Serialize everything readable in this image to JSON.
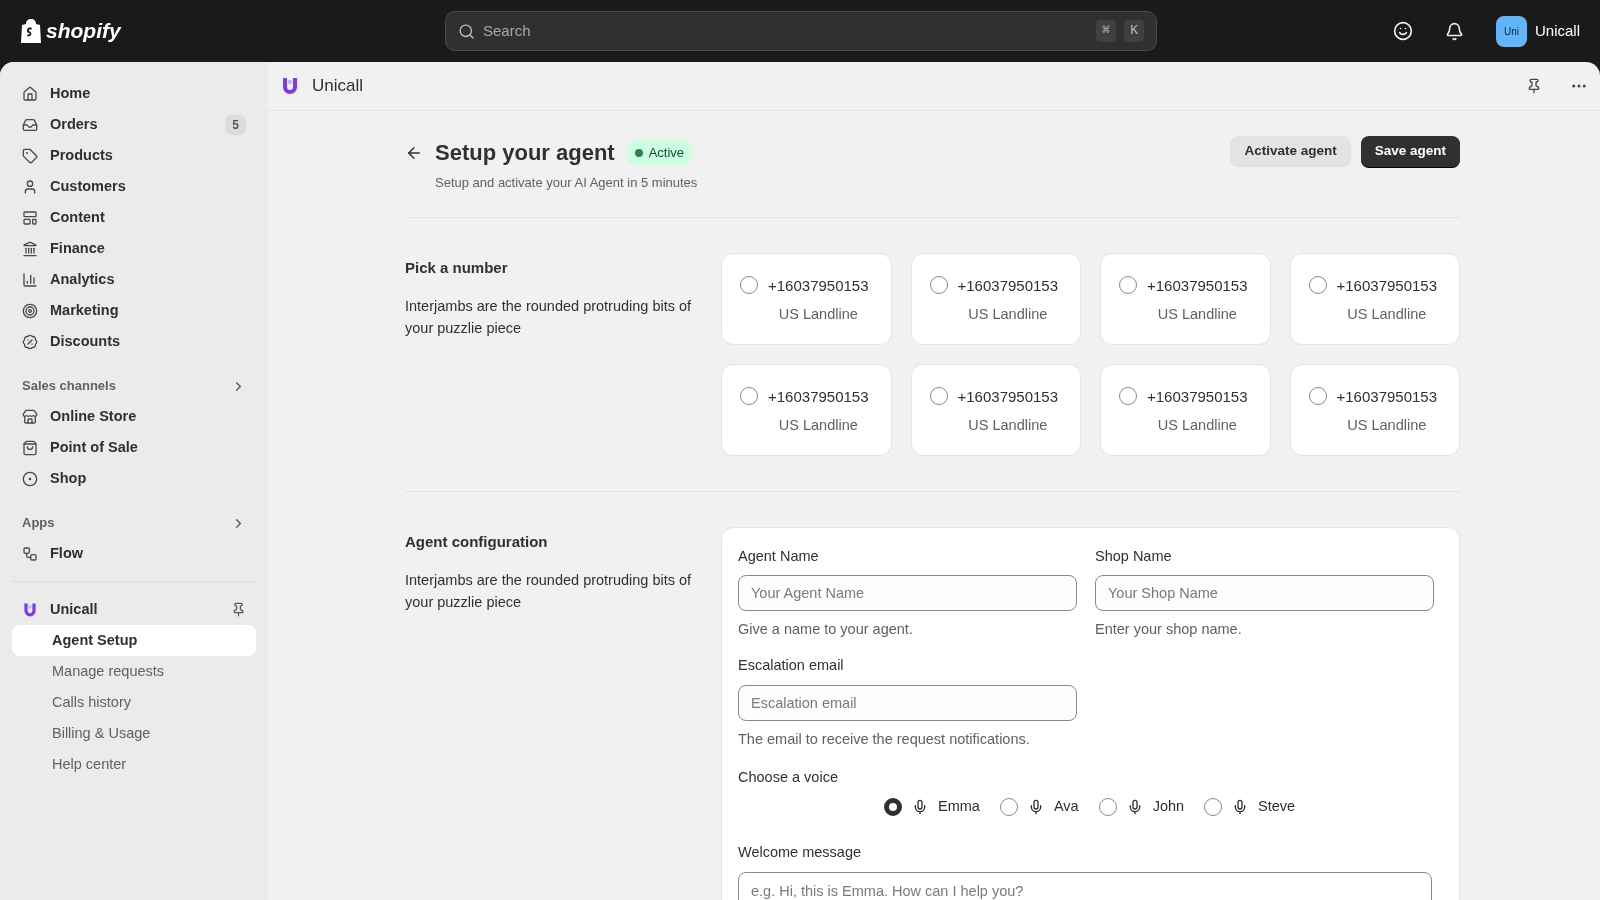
{
  "topbar": {
    "logo_text": "shopify",
    "search": {
      "placeholder": "Search"
    },
    "shortcut_keys": [
      "⌘",
      "K"
    ],
    "account": {
      "avatar": "Uni",
      "name": "Unicall"
    }
  },
  "sidebar": {
    "items": [
      {
        "label": "Home",
        "selected": false
      },
      {
        "label": "Orders",
        "badge": "5",
        "selected": false
      },
      {
        "label": "Products",
        "selected": false
      },
      {
        "label": "Customers",
        "selected": false
      },
      {
        "label": "Content",
        "selected": false
      },
      {
        "label": "Finance",
        "selected": false
      },
      {
        "label": "Analytics",
        "selected": false
      },
      {
        "label": "Marketing",
        "selected": false
      },
      {
        "label": "Discounts",
        "selected": false
      }
    ],
    "sales_channels": {
      "title": "Sales channels",
      "items": [
        {
          "label": "Online Store"
        },
        {
          "label": "Point of Sale"
        },
        {
          "label": "Shop"
        }
      ]
    },
    "apps": {
      "title": "Apps",
      "items": [
        {
          "label": "Flow"
        }
      ]
    },
    "app": {
      "label": "Unicall",
      "children": [
        {
          "label": "Agent Setup",
          "selected": true
        },
        {
          "label": "Manage requests",
          "selected": false
        },
        {
          "label": "Calls history",
          "selected": false
        },
        {
          "label": "Billing & Usage",
          "selected": false
        },
        {
          "label": "Help center",
          "selected": false
        }
      ]
    }
  },
  "app_header": {
    "title": "Unicall"
  },
  "page": {
    "title": "Setup your agent",
    "status": "Active",
    "subtitle": "Setup and activate your AI Agent in 5 minutes",
    "buttons": [
      {
        "label": "Activate agent",
        "kind": "secondary"
      },
      {
        "label": "Save agent",
        "kind": "primary"
      }
    ]
  },
  "numbers": {
    "title": "Pick a number",
    "description": "Interjambs are the rounded protruding bits of your puzzlie piece",
    "options": [
      {
        "number": "+16037950153",
        "type": "US Landline",
        "selected": false
      },
      {
        "number": "+16037950153",
        "type": "US Landline",
        "selected": false
      },
      {
        "number": "+16037950153",
        "type": "US Landline",
        "selected": false
      },
      {
        "number": "+16037950153",
        "type": "US Landline",
        "selected": false
      },
      {
        "number": "+16037950153",
        "type": "US Landline",
        "selected": false
      },
      {
        "number": "+16037950153",
        "type": "US Landline",
        "selected": false
      },
      {
        "number": "+16037950153",
        "type": "US Landline",
        "selected": false
      },
      {
        "number": "+16037950153",
        "type": "US Landline",
        "selected": false
      }
    ]
  },
  "config": {
    "title": "Agent configuration",
    "description": "Interjambs are the rounded protruding bits of your puzzlie piece",
    "fields": [
      {
        "label": "Agent Name",
        "placeholder": "Your Agent Name",
        "help": "Give a name to your agent."
      },
      {
        "label": "Shop Name",
        "placeholder": "Your Shop Name",
        "help": "Enter your shop name."
      },
      {
        "label": "Escalation email",
        "placeholder": "Escalation email",
        "help": "The email to receive the request notifications."
      }
    ],
    "voice": {
      "label": "Choose a voice",
      "options": [
        {
          "name": "Emma",
          "selected": true
        },
        {
          "name": "Ava",
          "selected": false
        },
        {
          "name": "John",
          "selected": false
        },
        {
          "name": "Steve",
          "selected": false
        }
      ]
    },
    "welcome": {
      "label": "Welcome message",
      "placeholder": "e.g. Hi, this is Emma. How can I help you?"
    }
  }
}
